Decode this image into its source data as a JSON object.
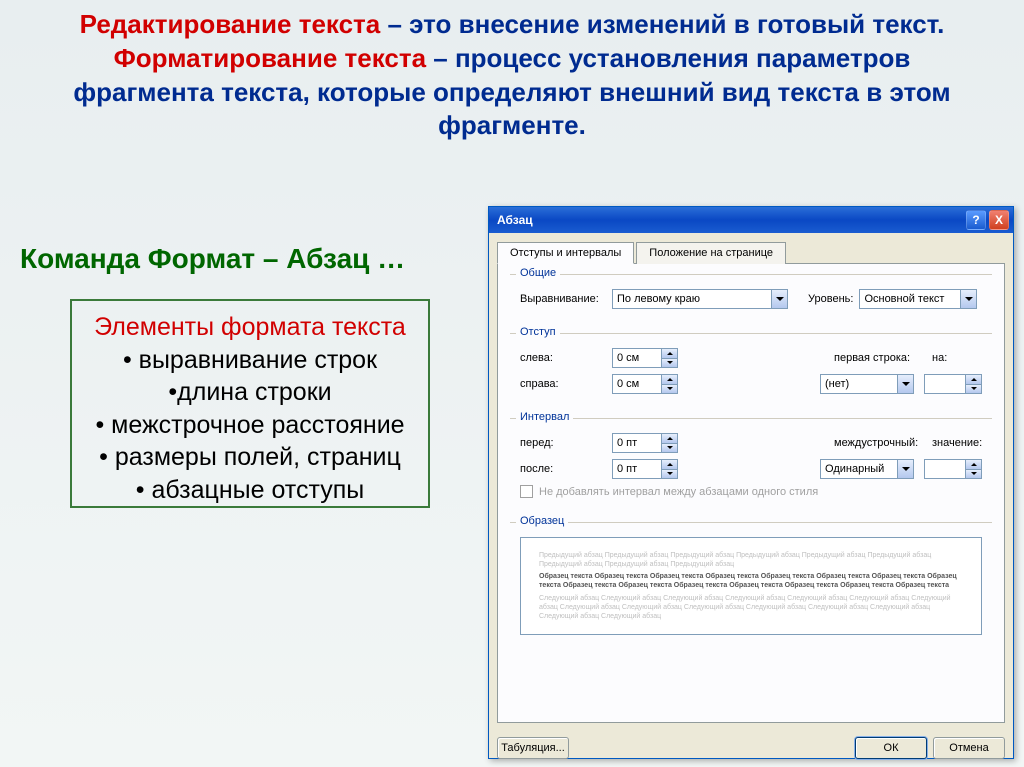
{
  "slide": {
    "def1_term": "Редактирование текста",
    "def1_rest": " – это внесение изменений в готовый текст.",
    "def2_term": "Форматирование текста",
    "def2_rest": " – процесс установления параметров фрагмента текста, которые определяют внешний вид текста в этом фрагменте.",
    "command": "Команда Формат – Абзац …",
    "elements_title": "Элементы формата текста",
    "elements": [
      "• выравнивание строк",
      "•длина строки",
      "• межстрочное расстояние",
      "• размеры полей, страниц",
      "• абзацные отступы"
    ]
  },
  "dialog": {
    "title": "Абзац",
    "help": "?",
    "close": "X",
    "tabs": {
      "active": "Отступы и интервалы",
      "other": "Положение на странице"
    },
    "general": {
      "legend": "Общие",
      "align_label": "Выравнивание:",
      "align_value": "По левому краю",
      "level_label": "Уровень:",
      "level_value": "Основной текст"
    },
    "indent": {
      "legend": "Отступ",
      "left_label": "слева:",
      "left_value": "0 см",
      "right_label": "справа:",
      "right_value": "0 см",
      "first_label": "первая строка:",
      "first_value": "(нет)",
      "by_label": "на:",
      "by_value": ""
    },
    "spacing": {
      "legend": "Интервал",
      "before_label": "перед:",
      "before_value": "0 пт",
      "after_label": "после:",
      "after_value": "0 пт",
      "line_label": "междустрочный:",
      "line_value": "Одинарный",
      "val_label": "значение:",
      "val_value": "",
      "nospace_label": "Не добавлять интервал между абзацами одного стиля"
    },
    "preview": {
      "legend": "Образец",
      "grey1": "Предыдущий абзац Предыдущий абзац Предыдущий абзац Предыдущий абзац Предыдущий абзац Предыдущий абзац Предыдущий абзац Предыдущий абзац Предыдущий абзац",
      "dark": "Образец текста Образец текста Образец текста Образец текста Образец текста Образец текста Образец текста Образец текста Образец текста Образец текста Образец текста Образец текста Образец текста Образец текста Образец текста",
      "grey2": "Следующий абзац Следующий абзац Следующий абзац Следующий абзац Следующий абзац Следующий абзац Следующий абзац Следующий абзац Следующий абзац Следующий абзац Следующий абзац Следующий абзац Следующий абзац Следующий абзац Следующий абзац"
    },
    "buttons": {
      "tabs": "Табуляция...",
      "ok": "ОК",
      "cancel": "Отмена"
    }
  }
}
